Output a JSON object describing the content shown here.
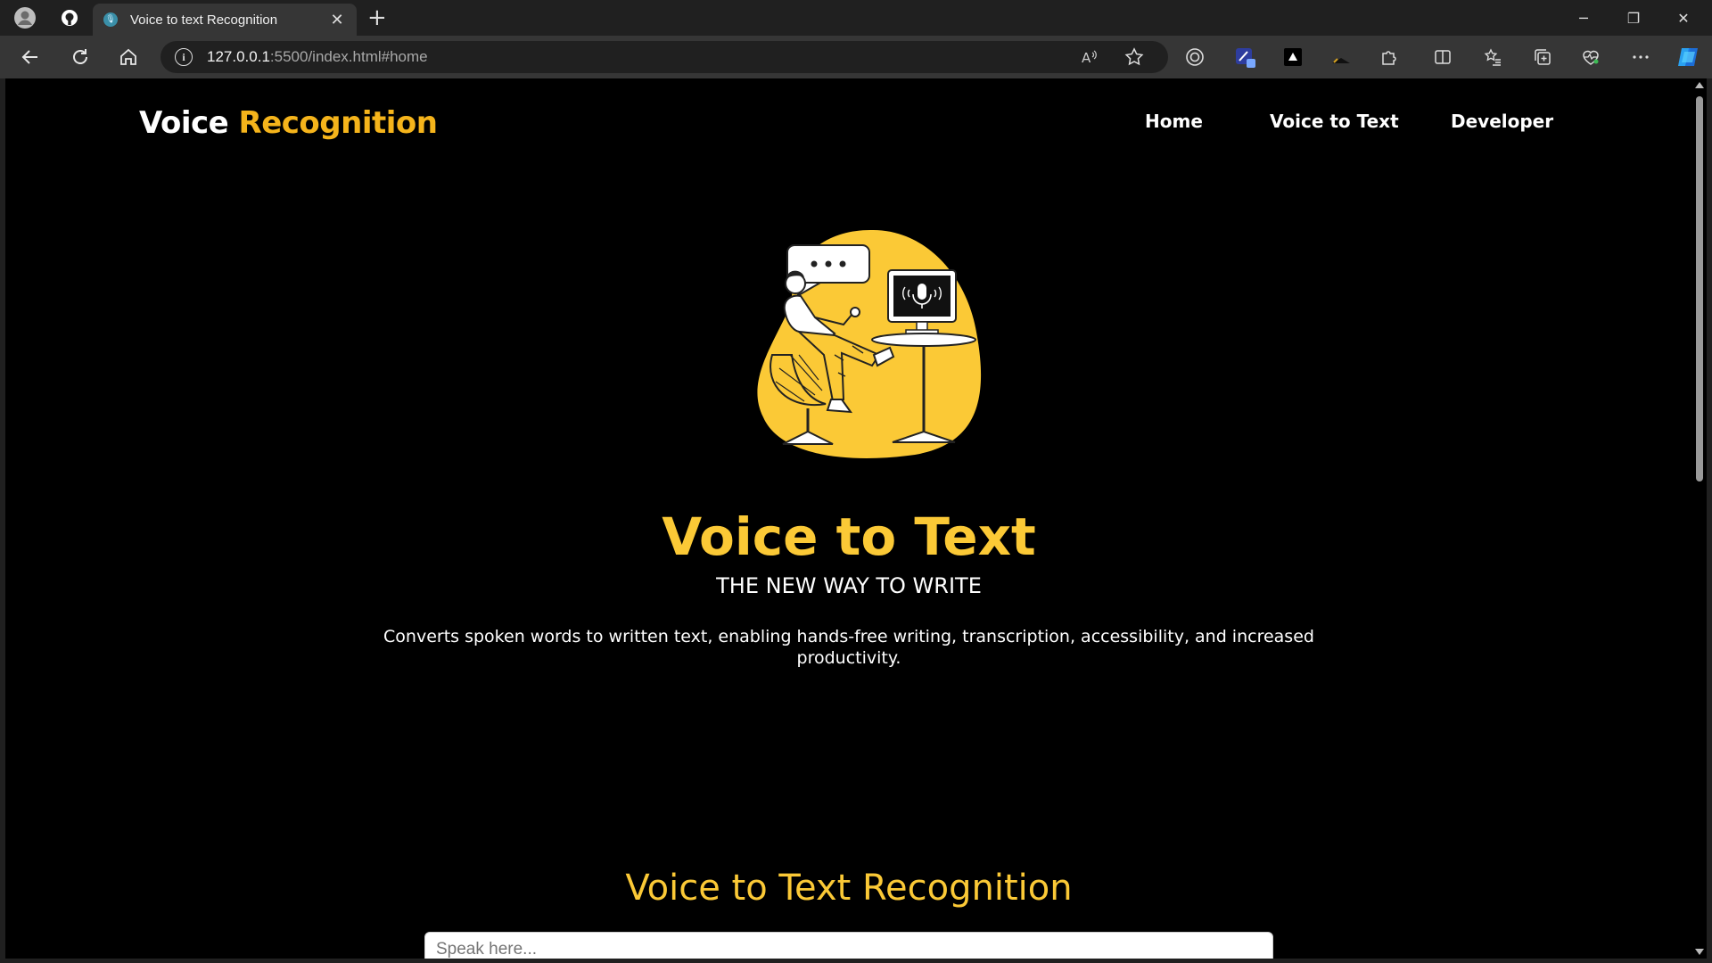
{
  "browser": {
    "tab_title": "Voice to text Recognition",
    "tab_close": "✕",
    "new_tab": "+",
    "url_host": "127.0.0.1",
    "url_rest": ":5500/index.html#home",
    "window_controls": {
      "minimize": "─",
      "restore": "❐",
      "close": "✕"
    }
  },
  "site": {
    "brand_first": "Voice ",
    "brand_second": "Recognition",
    "nav": [
      "Home",
      "Voice to Text",
      "Developer"
    ],
    "hero_title": "Voice to Text",
    "hero_subtitle": "THE NEW WAY TO WRITE",
    "hero_description": "Converts spoken words to written text, enabling hands-free writing, transcription, accessibility, and increased productivity.",
    "section_title": "Voice to Text Recognition",
    "input_placeholder": "Speak here..."
  },
  "colors": {
    "accent": "#fbc936",
    "brand_accent": "#f5b41b",
    "page_bg": "#000000",
    "chrome_bg": "#202020",
    "toolbar_bg": "#363636"
  }
}
